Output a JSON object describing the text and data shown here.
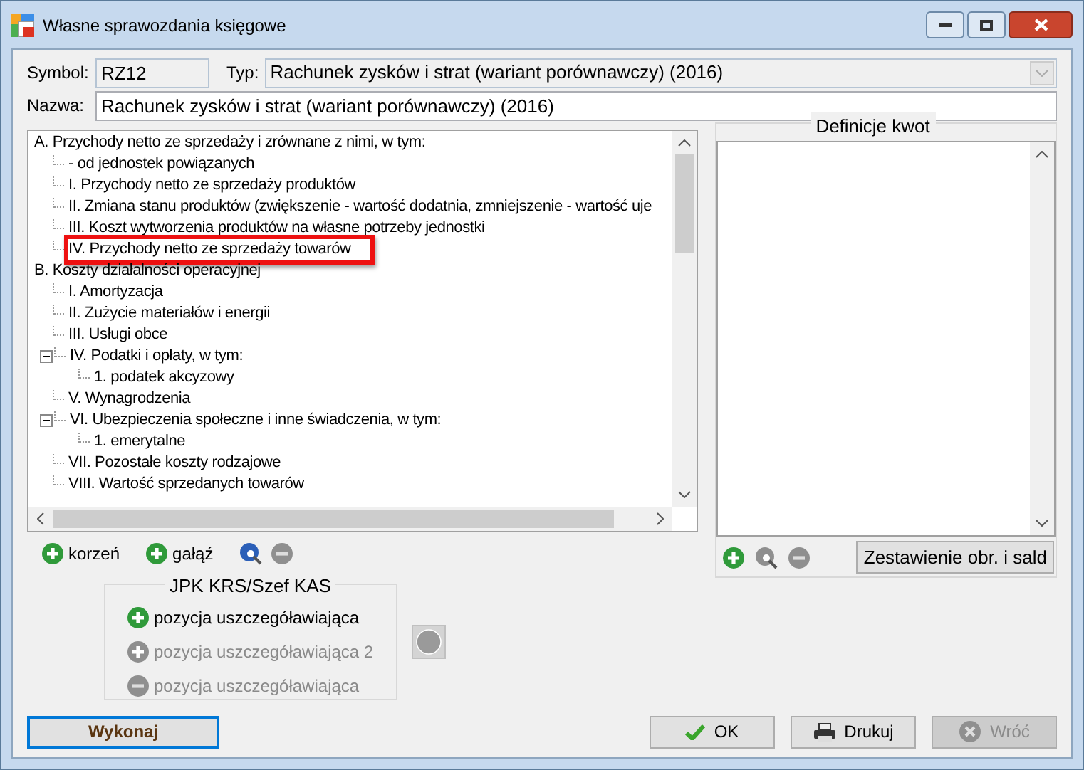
{
  "window": {
    "title": "Własne sprawozdania księgowe"
  },
  "symbol": {
    "label": "Symbol:",
    "value": "RZ12"
  },
  "type": {
    "label": "Typ:",
    "value": "Rachunek zysków i strat (wariant porównawczy) (2016)"
  },
  "name": {
    "label": "Nazwa:",
    "value": "Rachunek zysków i strat (wariant porównawczy) (2016)"
  },
  "tree": {
    "items": [
      {
        "label": "A. Przychody netto ze sprzedaży i zrównane z nimi, w tym:",
        "children": [
          {
            "label": "- od jednostek powiązanych"
          },
          {
            "label": "I. Przychody netto ze sprzedaży produktów"
          },
          {
            "label": "II. Zmiana stanu produktów (zwiększenie - wartość dodatnia, zmniejszenie - wartość uje"
          },
          {
            "label": "III. Koszt wytworzenia produktów na własne potrzeby jednostki"
          },
          {
            "label": "IV. Przychody netto ze sprzedaży towarów",
            "highlighted": true
          }
        ]
      },
      {
        "label": "B. Koszty działalności operacyjnej",
        "children": [
          {
            "label": "I. Amortyzacja"
          },
          {
            "label": "II. Zużycie materiałów i energii"
          },
          {
            "label": "III. Usługi obce"
          },
          {
            "label": "IV. Podatki i opłaty, w tym:",
            "expanded": true,
            "children": [
              {
                "label": "1. podatek akcyzowy"
              }
            ]
          },
          {
            "label": "V. Wynagrodzenia"
          },
          {
            "label": "VI. Ubezpieczenia społeczne i inne świadczenia, w tym:",
            "expanded": true,
            "children": [
              {
                "label": "1. emerytalne"
              }
            ]
          },
          {
            "label": "VII. Pozostałe koszty rodzajowe"
          },
          {
            "label": "VIII. Wartość sprzedanych towarów"
          }
        ]
      }
    ]
  },
  "tree_toolbar": [
    {
      "kind": "add",
      "label": "korzeń",
      "disabled": false
    },
    {
      "kind": "add",
      "label": "gałąź",
      "disabled": false
    },
    {
      "kind": "preview",
      "disabled": false
    },
    {
      "kind": "remove",
      "disabled": true
    }
  ],
  "definitions": {
    "title": "Definicje kwot",
    "toolbar": [
      {
        "kind": "add",
        "disabled": false
      },
      {
        "kind": "preview",
        "disabled": true
      },
      {
        "kind": "remove",
        "disabled": true
      }
    ],
    "button": "Zestawienie obr. i sald"
  },
  "jpk": {
    "title": "JPK KRS/Szef KAS",
    "items": [
      {
        "kind": "add",
        "label": "pozycja uszczegóławiająca",
        "disabled": false
      },
      {
        "kind": "add",
        "label": "pozycja uszczegóławiająca 2",
        "disabled": true
      },
      {
        "kind": "remove",
        "label": "pozycja uszczegóławiająca",
        "disabled": true
      }
    ]
  },
  "buttons": [
    {
      "kind": "run",
      "label": "Wykonaj",
      "focused": true,
      "disabled": false
    },
    {
      "kind": "ok",
      "label": "OK",
      "focused": false,
      "disabled": false
    },
    {
      "kind": "print",
      "label": "Drukuj",
      "focused": false,
      "disabled": false
    },
    {
      "kind": "back",
      "label": "Wróć",
      "focused": false,
      "disabled": true
    }
  ]
}
